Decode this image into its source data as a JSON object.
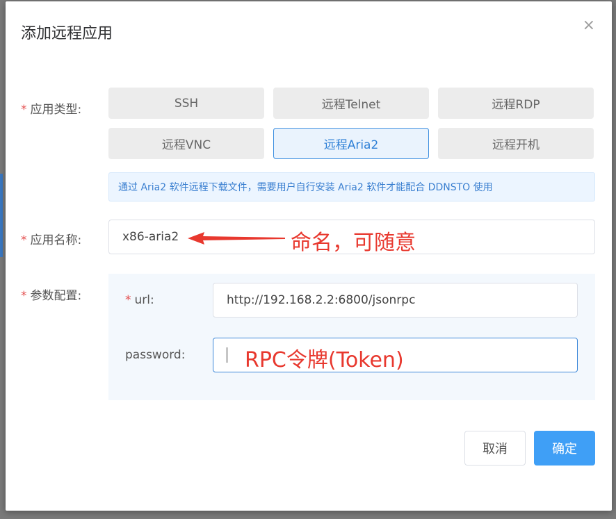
{
  "dialog": {
    "title": "添加远程应用",
    "close_glyph": "×"
  },
  "form": {
    "type_label": "应用类型:",
    "name_label": "应用名称:",
    "params_label": "参数配置:",
    "required_mark": "*",
    "options": [
      "SSH",
      "远程Telnet",
      "远程RDP",
      "远程VNC",
      "远程Aria2",
      "远程开机"
    ],
    "selected_option": "远程Aria2",
    "tip": "通过 Aria2 软件远程下载文件，需要用户自行安装 Aria2 软件才能配合 DDNSTO 使用",
    "name_value": "x86-aria2",
    "url_label": "url:",
    "url_value": "http://192.168.2.2:6800/jsonrpc",
    "password_label": "password:",
    "password_value": ""
  },
  "annotations": {
    "name_note": "命名，可随意",
    "token_note": "RPC令牌(Token)",
    "color": "#e8382e"
  },
  "footer": {
    "cancel_label": "取消",
    "ok_label": "确定"
  },
  "colors": {
    "primary": "#3f9ff6",
    "required": "#e34d4d"
  }
}
